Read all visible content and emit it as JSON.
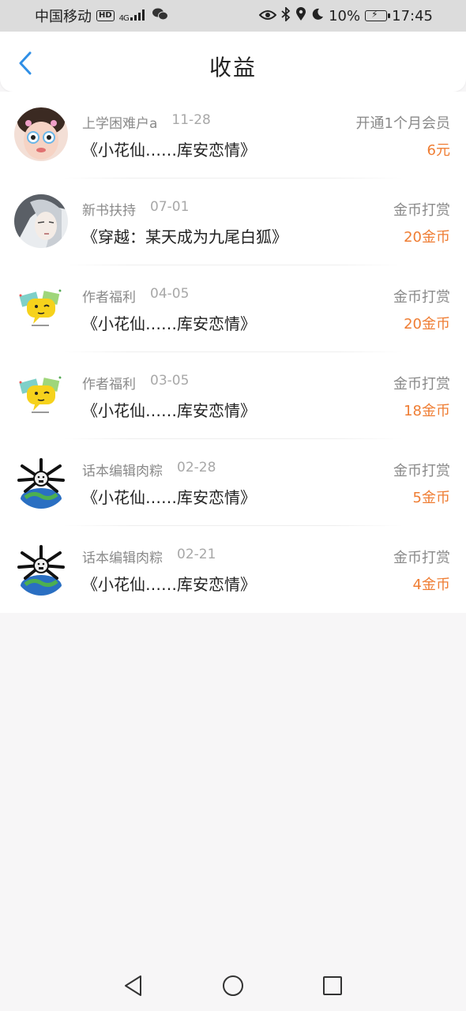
{
  "status_bar": {
    "carrier": "中国移动",
    "hd_badge": "HD",
    "network": "4G",
    "battery_percent": "10%",
    "time": "17:45",
    "icons": [
      "eye-icon",
      "bluetooth-icon",
      "location-icon",
      "moon-icon",
      "battery-charging-icon",
      "wechat-icon"
    ]
  },
  "header": {
    "title": "收益"
  },
  "records": [
    {
      "user": "上学困难户a",
      "date": "11-28",
      "book": "《小花仙……库安恋情》",
      "type": "开通1个月会员",
      "amount": "6元",
      "avatar": "girl-avatar"
    },
    {
      "user": "新书扶持",
      "date": "07-01",
      "book": "《穿越：某天成为九尾白狐》",
      "type": "金币打赏",
      "amount": "20金币",
      "avatar": "anime-avatar"
    },
    {
      "user": "作者福利",
      "date": "04-05",
      "book": "《小花仙……库安恋情》",
      "type": "金币打赏",
      "amount": "20金币",
      "avatar": "chat-bubble-avatar"
    },
    {
      "user": "作者福利",
      "date": "03-05",
      "book": "《小花仙……库安恋情》",
      "type": "金币打赏",
      "amount": "18金币",
      "avatar": "chat-bubble-avatar"
    },
    {
      "user": "话本编辑肉粽",
      "date": "02-28",
      "book": "《小花仙……库安恋情》",
      "type": "金币打赏",
      "amount": "5金币",
      "avatar": "globe-avatar"
    },
    {
      "user": "话本编辑肉粽",
      "date": "02-21",
      "book": "《小花仙……库安恋情》",
      "type": "金币打赏",
      "amount": "4金币",
      "avatar": "globe-avatar"
    }
  ],
  "colors": {
    "accent": "#2f8fe6",
    "amount": "#ef7d33"
  }
}
